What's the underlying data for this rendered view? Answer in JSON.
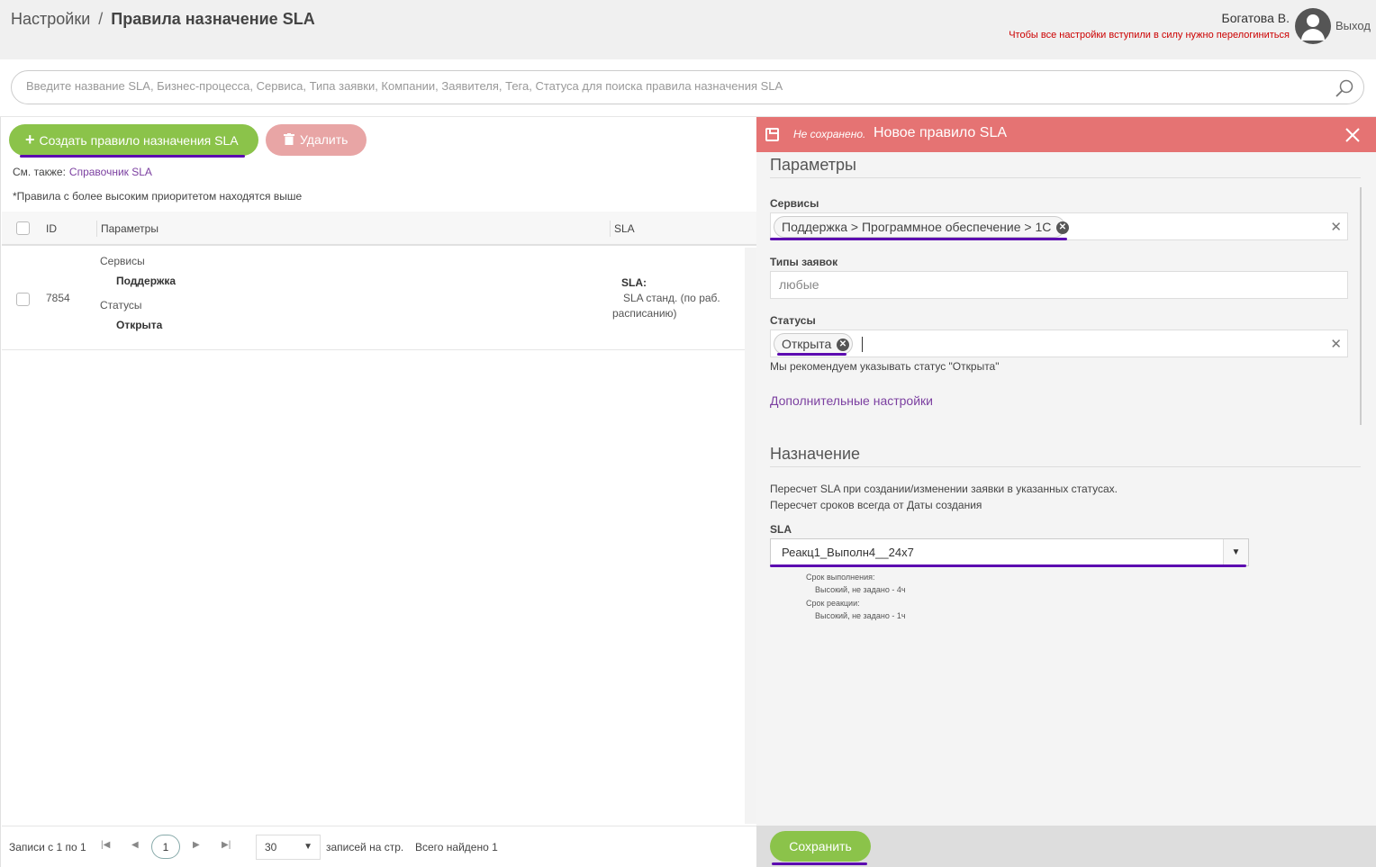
{
  "breadcrumb": {
    "root": "Настройки",
    "separator": "/",
    "current": "Правила назначение SLA"
  },
  "user": {
    "name": "Богатова В.",
    "warning": "Чтобы все настройки вступили в силу нужно перелогиниться",
    "logout": "Выход"
  },
  "search": {
    "placeholder": "Введите название SLA, Бизнес-процесса, Сервиса, Типа заявки, Компании, Заявителя, Тега, Статуса для поиска правила назначения SLA"
  },
  "toolbar": {
    "create_label": "Создать правило назначения SLA",
    "delete_label": "Удалить"
  },
  "see_also": {
    "label": "См. также:",
    "link": "Справочник SLA"
  },
  "priority_note": "*Правила с более высоким приоритетом находятся выше",
  "table": {
    "columns": [
      "ID",
      "Параметры",
      "SLA"
    ],
    "rows": [
      {
        "id": "7854",
        "services_label": "Сервисы",
        "services_value": "Поддержка",
        "statuses_label": "Статусы",
        "statuses_value": "Открыта",
        "sla_label": "SLA:",
        "sla_value_1": "SLA станд. (по раб.",
        "sla_value_2": "расписанию)"
      }
    ]
  },
  "pagination": {
    "records": "Записи с 1 по 1",
    "current_page": "1",
    "per_page": "30",
    "per_page_label": "записей на стр.",
    "total": "Всего найдено 1"
  },
  "panel": {
    "status": "Не сохранено.",
    "title": "Новое правило SLA",
    "params_section": "Параметры",
    "services_label": "Сервисы",
    "services_chip": "Поддержка > Программное обеспечение > 1С",
    "types_label": "Типы заявок",
    "types_placeholder": "любые",
    "statuses_label": "Статусы",
    "statuses_chip": "Открыта",
    "statuses_hint": "Мы рекомендуем указывать статус \"Открыта\"",
    "advanced_link": "Дополнительные настройки",
    "assign_section": "Назначение",
    "recalc_1": "Пересчет SLA при создании/изменении заявки в указанных статусах.",
    "recalc_2": "Пересчет сроков всегда от Даты создания",
    "sla_label": "SLA",
    "sla_value": "Реакц1_Выполн4__24x7",
    "exec_label": "Срок выполнения:",
    "exec_value": "Высокий, не задано - 4ч",
    "react_label": "Срок реакции:",
    "react_value": "Высокий, не задано - 1ч",
    "save_label": "Сохранить"
  },
  "colors": {
    "accent_green": "#8bc34a",
    "header_red": "#e57373",
    "underline_purple": "#5c0ab0",
    "link_purple": "#7b3fa0"
  }
}
